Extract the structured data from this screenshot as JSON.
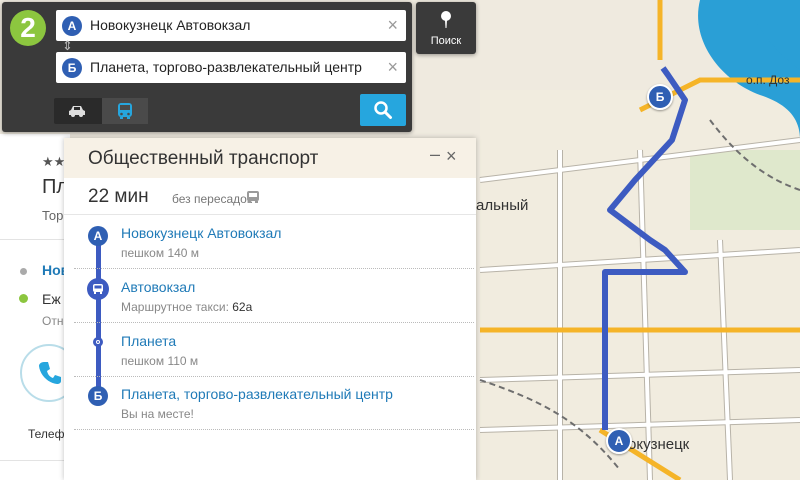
{
  "search": {
    "logo": "2",
    "from": {
      "letter": "А",
      "value": "Новокузнецк Автовокзал"
    },
    "to": {
      "letter": "Б",
      "value": "Планета, торгово-развлекательный центр"
    },
    "clear": "×",
    "swap": "⇕",
    "modes": [
      {
        "name": "car",
        "icon": "car-icon",
        "active": false
      },
      {
        "name": "bus",
        "icon": "bus-icon",
        "active": true
      }
    ],
    "search_icon": "magnifier-icon",
    "poisk_label": "Поиск",
    "accent": "#26a6de"
  },
  "info": {
    "stars": "★★",
    "name": "Пл",
    "type": "Тор",
    "link": "Нов",
    "hours": "Еж",
    "hours2": "Отн",
    "phone_label": "Телеф"
  },
  "route": {
    "title": "Общественный транспорт",
    "minimize": "–",
    "close": "×",
    "time": "22 мин",
    "transfers": "без пересадок",
    "steps": [
      {
        "kind": "start",
        "letter": "А",
        "title": "Новокузнецк Автовокзал",
        "sub": "пешком 140 м"
      },
      {
        "kind": "bus",
        "title": "Автовокзал",
        "sub": "Маршрутное такси: ",
        "sub_value": "62а"
      },
      {
        "kind": "stop",
        "title": "Планета",
        "sub": "пешком 110 м"
      },
      {
        "kind": "end",
        "letter": "Б",
        "title": "Планета, торгово-развлекательный центр",
        "sub": "Вы на месте!"
      }
    ],
    "line_color": "#3d5bc1"
  },
  "map": {
    "labels": {
      "station": "о.п. Доз",
      "district": "альный",
      "city": "окузнецк"
    },
    "markers": {
      "a": "А",
      "b": "Б"
    },
    "colors": {
      "route": "#3d5bc1",
      "main_road": "#f5b428",
      "rail": "#6e6e6e",
      "water": "#2a9fd6"
    }
  }
}
